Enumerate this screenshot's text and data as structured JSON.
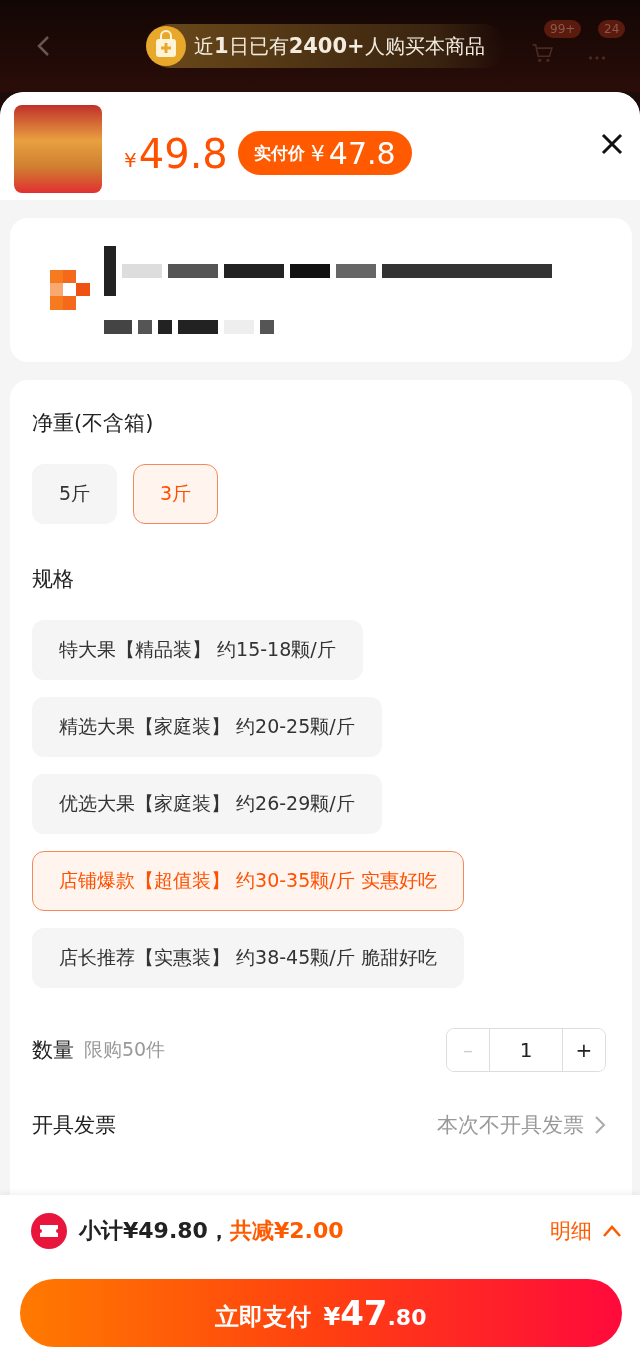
{
  "header": {
    "banner": "近**1**日已有**2400+**人购买本商品",
    "cart_badge": "99+",
    "more_badge": "24"
  },
  "product": {
    "currency": "¥",
    "price": "49.8",
    "final_label": "实付价",
    "final_currency": "¥",
    "final_price": "47.8"
  },
  "weight": {
    "title": "净重(不含箱)",
    "options": [
      {
        "label": "5斤",
        "selected": false
      },
      {
        "label": "3斤",
        "selected": true
      }
    ]
  },
  "spec": {
    "title": "规格",
    "options": [
      {
        "label": "特大果【精品装】 约15-18颗/斤",
        "selected": false
      },
      {
        "label": "精选大果【家庭装】 约20-25颗/斤",
        "selected": false
      },
      {
        "label": "优选大果【家庭装】 约26-29颗/斤",
        "selected": false
      },
      {
        "label": "店铺爆款【超值装】 约30-35颗/斤 实惠好吃",
        "selected": true
      },
      {
        "label": "店长推荐【实惠装】 约38-45颗/斤 脆甜好吃",
        "selected": false
      }
    ]
  },
  "quantity": {
    "label": "数量",
    "limit": "限购50件",
    "minus": "–",
    "value": "1",
    "plus": "+",
    "minus_disabled": true
  },
  "invoice": {
    "label": "开具发票",
    "value": "本次不开具发票"
  },
  "footer": {
    "subtotal": "小计¥49.80，",
    "discount": "共减¥2.00",
    "details": "明细",
    "pay": {
      "label": "立即支付",
      "currency": "¥",
      "integer": "47",
      "decimal": ".80"
    }
  }
}
